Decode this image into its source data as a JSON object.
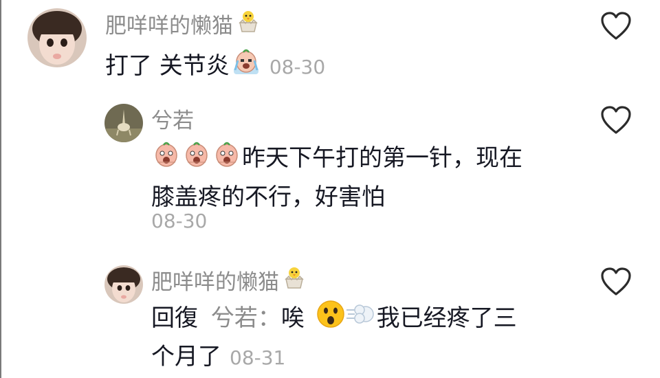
{
  "comments": [
    {
      "username": "肥咩咩的懒猫",
      "username_icon": "chick-emoji-icon",
      "text": "打了 关节炎",
      "inline_icon": "crying-bean-emoji-icon",
      "date": "08-30"
    },
    {
      "username": "兮若",
      "leading_icons": [
        "scared-bean-emoji-icon",
        "scared-bean-emoji-icon",
        "scared-bean-emoji-icon"
      ],
      "text_line1": "昨天下午打的第一针，现在",
      "text_line2": "膝盖疼的不行，好害怕",
      "date": "08-30"
    },
    {
      "username": "肥咩咩的懒猫",
      "username_icon": "chick-emoji-icon",
      "reply_prefix": "回復",
      "reply_to": "兮若：",
      "text_part1": "唉",
      "inline_icons": [
        "astonished-face-emoji-icon",
        "dash-puff-emoji-icon"
      ],
      "text_part2": "我已经疼了三",
      "text_line2": "个月了",
      "date": "08-31"
    }
  ],
  "colors": {
    "text": "#161823",
    "muted": "#8c8c8c",
    "date": "#a8a8a8",
    "heart_stroke": "#2b2b2b"
  }
}
